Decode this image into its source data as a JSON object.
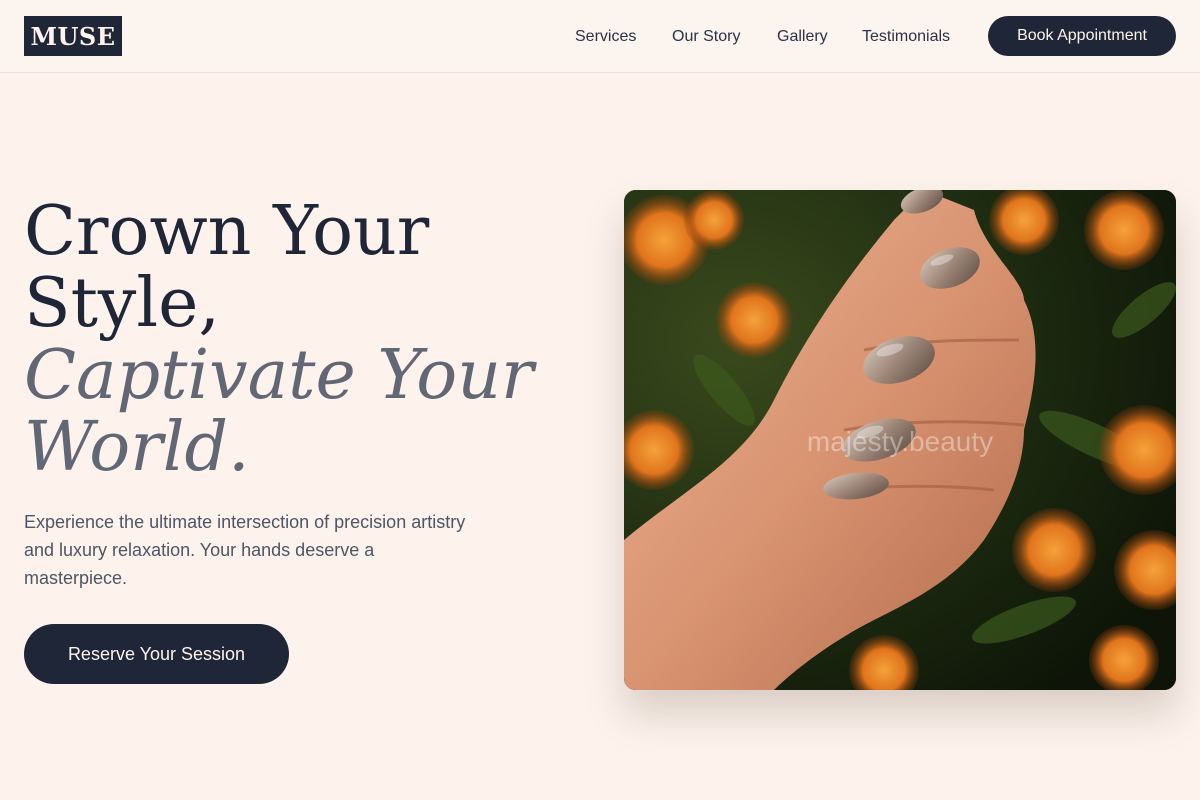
{
  "header": {
    "logo": "MUSE",
    "nav": [
      "Services",
      "Our Story",
      "Gallery",
      "Testimonials"
    ],
    "cta": "Book Appointment"
  },
  "hero": {
    "title_line1": "Crown Your",
    "title_line2": "Style,",
    "title_italic1": "Captivate Your",
    "title_italic2": "World.",
    "description": "Experience the ultimate intersection of precision artistry and luxury relaxation. Your hands deserve a masterpiece.",
    "cta": "Reserve Your Session",
    "image": {
      "subject": "hand with chrome taupe almond nails over orange marigolds",
      "watermark": "majesty.beauty"
    }
  },
  "colors": {
    "primary": "#1e2638",
    "background": "#fdf3ec",
    "muted_text": "#626775"
  }
}
